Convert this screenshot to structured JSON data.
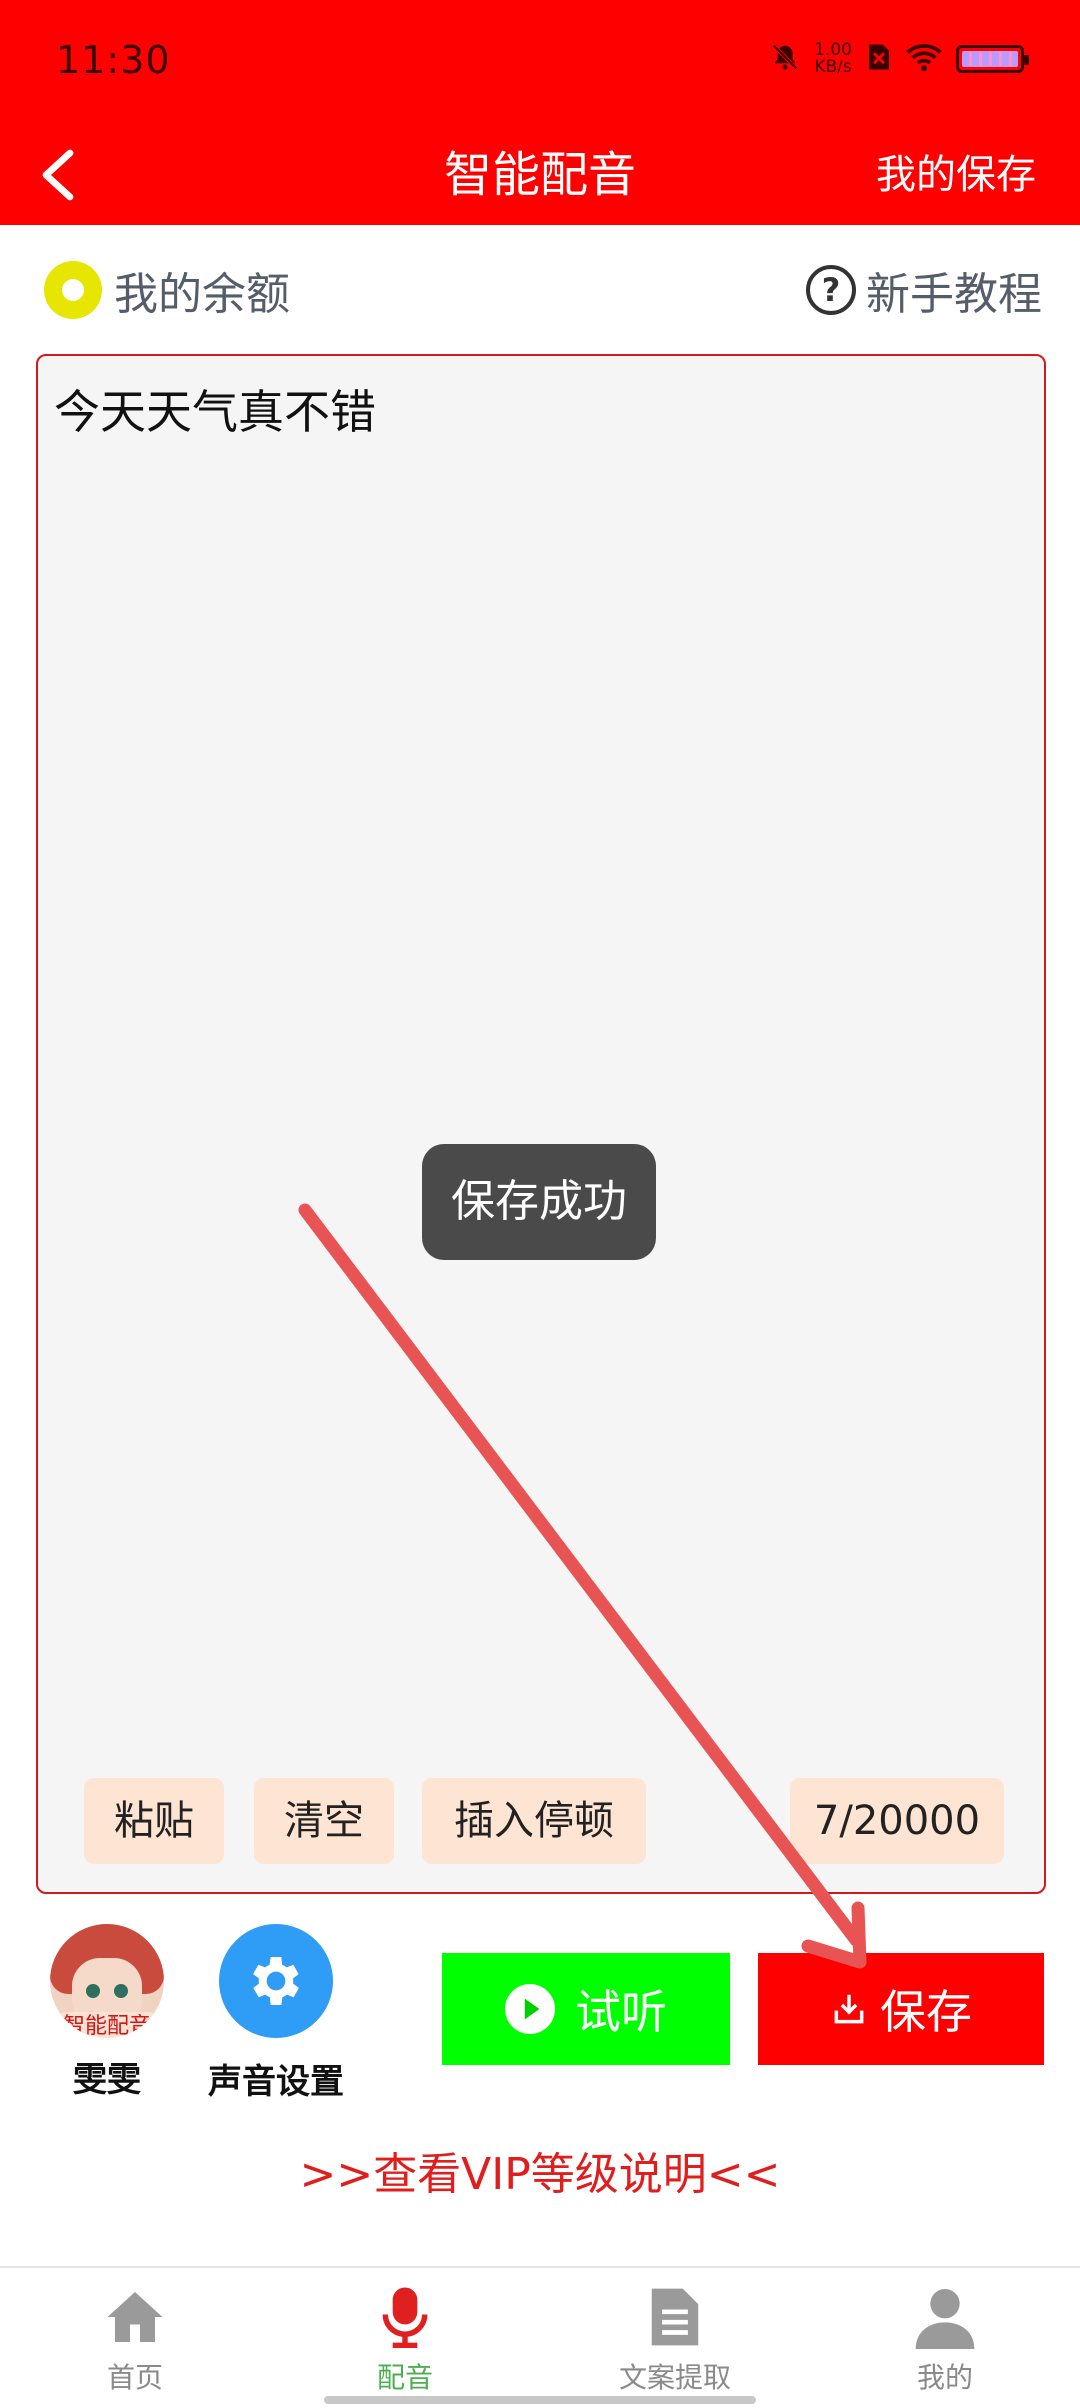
{
  "status_bar": {
    "time": "11:30",
    "net_speed_value": "1.00",
    "net_speed_unit": "KB/s"
  },
  "app_bar": {
    "title": "智能配音",
    "right_action": "我的保存"
  },
  "balance": {
    "label": "我的余额"
  },
  "tutorial": {
    "label": "新手教程",
    "icon_char": "?"
  },
  "editor": {
    "text": "今天天气真不错",
    "chips": {
      "paste": "粘贴",
      "clear": "清空",
      "insert_pause": "插入停顿",
      "char_count": "7/20000"
    }
  },
  "toast": {
    "text": "保存成功"
  },
  "voice": {
    "badge": "智能配音",
    "name": "雯雯"
  },
  "voice_settings": {
    "label": "声音设置"
  },
  "actions": {
    "listen": "试听",
    "save": "保存"
  },
  "vip_link": {
    "text": ">>查看VIP等级说明<<"
  },
  "bottom_nav": {
    "items": [
      {
        "label": "首页",
        "icon": "home-icon"
      },
      {
        "label": "配音",
        "icon": "microphone-icon"
      },
      {
        "label": "文案提取",
        "icon": "document-icon"
      },
      {
        "label": "我的",
        "icon": "user-icon"
      }
    ],
    "active_index": 1
  },
  "colors": {
    "primary_red": "#ff0000",
    "listen_green": "#00ff00",
    "chip_bg": "#fde4d3",
    "active_nav": "#4caf50",
    "annotation_arrow": "#e85454"
  }
}
